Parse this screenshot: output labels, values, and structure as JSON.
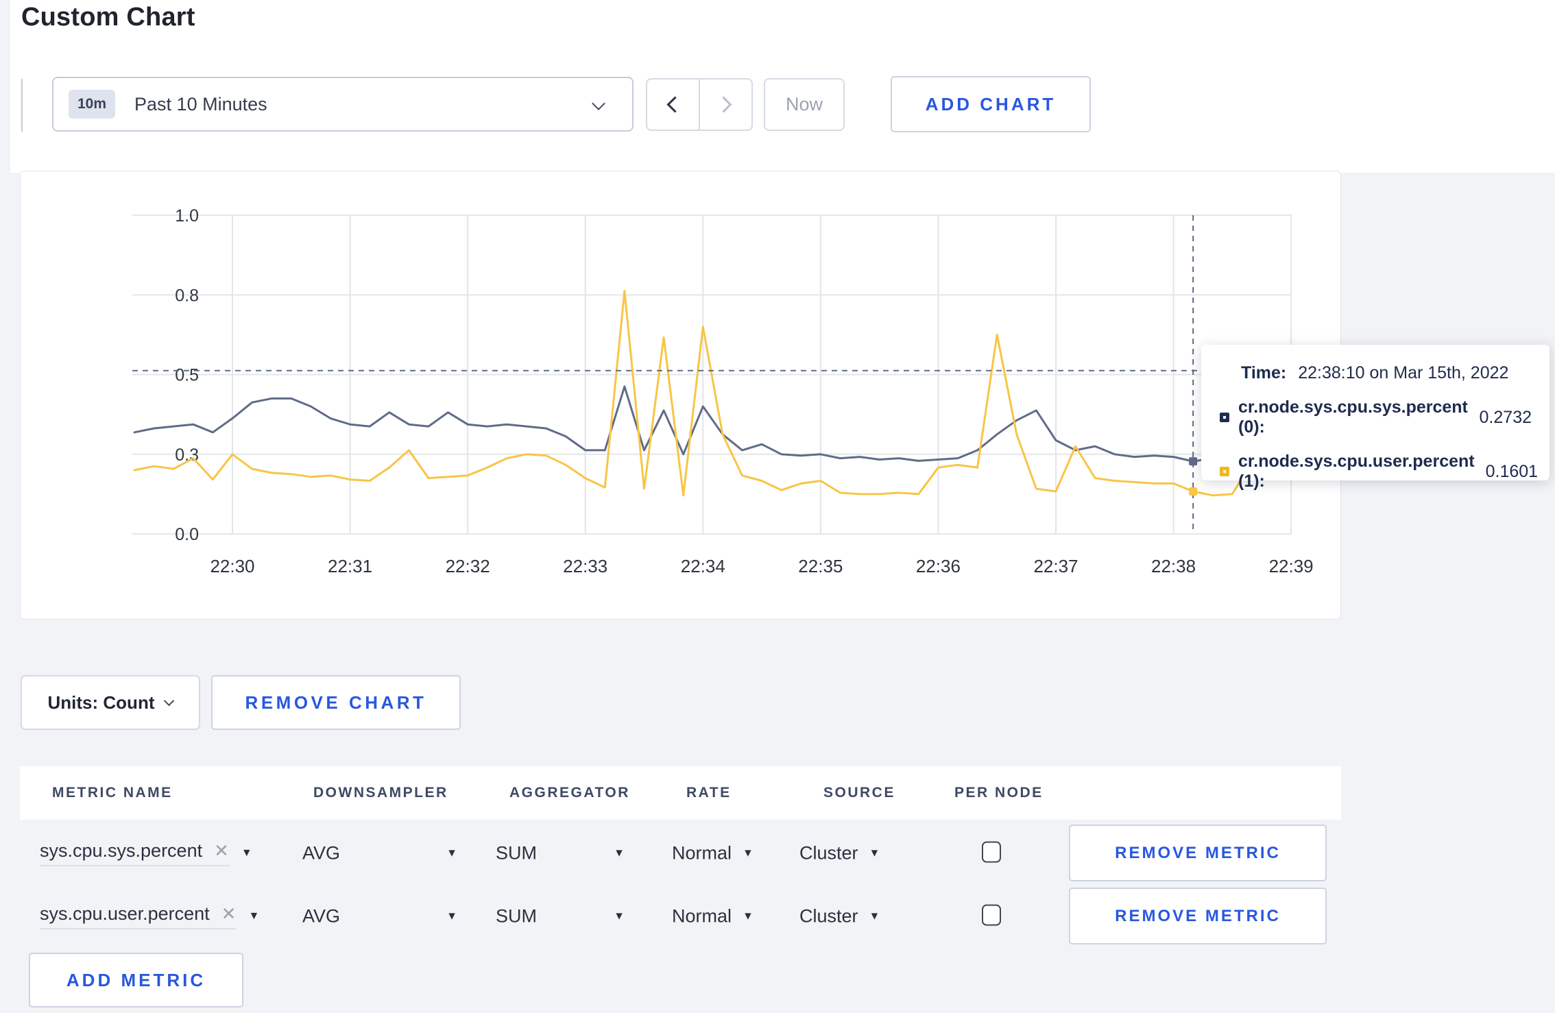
{
  "page": {
    "title": "Custom Chart"
  },
  "toolbar": {
    "time_badge": "10m",
    "time_label": "Past 10 Minutes",
    "now_label": "Now",
    "add_chart_label": "ADD CHART"
  },
  "chart_data": {
    "type": "line",
    "title": "",
    "xlabel": "",
    "ylabel": "",
    "grid": true,
    "legend_position": "tooltip",
    "x_ticks": [
      "22:30",
      "22:31",
      "22:32",
      "22:33",
      "22:34",
      "22:35",
      "22:36",
      "22:37",
      "22:38",
      "22:39"
    ],
    "y_ticks": [
      0.0,
      0.3,
      0.5,
      0.8,
      1.0
    ],
    "y_tick_labels": [
      "0.0",
      "0.3",
      "0.5",
      "0.8",
      "1.0"
    ],
    "series": [
      {
        "name": "cr.node.sys.cpu.sys.percent",
        "node": "(0)",
        "color": "#5f6c87",
        "points": [
          [
            "22:29:10",
            0.355
          ],
          [
            "22:29:20",
            0.365
          ],
          [
            "22:29:30",
            0.37
          ],
          [
            "22:29:40",
            0.375
          ],
          [
            "22:29:50",
            0.355
          ],
          [
            "22:30:00",
            0.39
          ],
          [
            "22:30:10",
            0.43
          ],
          [
            "22:30:20",
            0.44
          ],
          [
            "22:30:30",
            0.44
          ],
          [
            "22:30:40",
            0.42
          ],
          [
            "22:30:50",
            0.39
          ],
          [
            "22:31:00",
            0.375
          ],
          [
            "22:31:10",
            0.37
          ],
          [
            "22:31:20",
            0.405
          ],
          [
            "22:31:30",
            0.375
          ],
          [
            "22:31:40",
            0.37
          ],
          [
            "22:31:50",
            0.405
          ],
          [
            "22:32:00",
            0.375
          ],
          [
            "22:32:10",
            0.37
          ],
          [
            "22:32:20",
            0.375
          ],
          [
            "22:32:30",
            0.37
          ],
          [
            "22:32:40",
            0.365
          ],
          [
            "22:32:50",
            0.345
          ],
          [
            "22:33:00",
            0.31
          ],
          [
            "22:33:10",
            0.31
          ],
          [
            "22:33:20",
            0.47
          ],
          [
            "22:33:30",
            0.31
          ],
          [
            "22:33:40",
            0.41
          ],
          [
            "22:33:50",
            0.3
          ],
          [
            "22:34:00",
            0.42
          ],
          [
            "22:34:10",
            0.35
          ],
          [
            "22:34:20",
            0.31
          ],
          [
            "22:34:30",
            0.325
          ],
          [
            "22:34:40",
            0.3
          ],
          [
            "22:34:50",
            0.295
          ],
          [
            "22:35:00",
            0.3
          ],
          [
            "22:35:10",
            0.285
          ],
          [
            "22:35:20",
            0.29
          ],
          [
            "22:35:30",
            0.28
          ],
          [
            "22:35:40",
            0.285
          ],
          [
            "22:35:50",
            0.275
          ],
          [
            "22:36:00",
            0.28
          ],
          [
            "22:36:10",
            0.285
          ],
          [
            "22:36:20",
            0.31
          ],
          [
            "22:36:30",
            0.35
          ],
          [
            "22:36:40",
            0.385
          ],
          [
            "22:36:50",
            0.41
          ],
          [
            "22:37:00",
            0.335
          ],
          [
            "22:37:10",
            0.31
          ],
          [
            "22:37:20",
            0.32
          ],
          [
            "22:37:30",
            0.3
          ],
          [
            "22:37:40",
            0.29
          ],
          [
            "22:37:50",
            0.295
          ],
          [
            "22:38:00",
            0.29
          ],
          [
            "22:38:10",
            0.2732
          ],
          [
            "22:38:20",
            0.285
          ],
          [
            "22:38:30",
            0.29
          ],
          [
            "22:38:40",
            0.3
          ],
          [
            "22:38:50",
            0.295
          ],
          [
            "22:39:00",
            0.3
          ]
        ]
      },
      {
        "name": "cr.node.sys.cpu.user.percent",
        "node": "(1)",
        "color": "#f8c545",
        "points": [
          [
            "22:29:10",
            0.24
          ],
          [
            "22:29:20",
            0.255
          ],
          [
            "22:29:30",
            0.245
          ],
          [
            "22:29:40",
            0.285
          ],
          [
            "22:29:50",
            0.205
          ],
          [
            "22:30:00",
            0.3
          ],
          [
            "22:30:10",
            0.245
          ],
          [
            "22:30:20",
            0.23
          ],
          [
            "22:30:30",
            0.225
          ],
          [
            "22:30:40",
            0.215
          ],
          [
            "22:30:50",
            0.22
          ],
          [
            "22:31:00",
            0.205
          ],
          [
            "22:31:10",
            0.2
          ],
          [
            "22:31:20",
            0.25
          ],
          [
            "22:31:30",
            0.31
          ],
          [
            "22:31:40",
            0.21
          ],
          [
            "22:31:50",
            0.215
          ],
          [
            "22:32:00",
            0.22
          ],
          [
            "22:32:10",
            0.25
          ],
          [
            "22:32:20",
            0.285
          ],
          [
            "22:32:30",
            0.3
          ],
          [
            "22:32:40",
            0.295
          ],
          [
            "22:32:50",
            0.26
          ],
          [
            "22:33:00",
            0.21
          ],
          [
            "22:33:10",
            0.175
          ],
          [
            "22:33:20",
            0.81
          ],
          [
            "22:33:30",
            0.17
          ],
          [
            "22:33:40",
            0.64
          ],
          [
            "22:33:50",
            0.145
          ],
          [
            "22:34:00",
            0.68
          ],
          [
            "22:34:10",
            0.35
          ],
          [
            "22:34:20",
            0.22
          ],
          [
            "22:34:30",
            0.2
          ],
          [
            "22:34:40",
            0.165
          ],
          [
            "22:34:50",
            0.19
          ],
          [
            "22:35:00",
            0.2
          ],
          [
            "22:35:10",
            0.155
          ],
          [
            "22:35:20",
            0.15
          ],
          [
            "22:35:30",
            0.15
          ],
          [
            "22:35:40",
            0.155
          ],
          [
            "22:35:50",
            0.15
          ],
          [
            "22:36:00",
            0.25
          ],
          [
            "22:36:10",
            0.26
          ],
          [
            "22:36:20",
            0.25
          ],
          [
            "22:36:30",
            0.65
          ],
          [
            "22:36:40",
            0.35
          ],
          [
            "22:36:50",
            0.17
          ],
          [
            "22:37:00",
            0.16
          ],
          [
            "22:37:10",
            0.32
          ],
          [
            "22:37:20",
            0.21
          ],
          [
            "22:37:30",
            0.2
          ],
          [
            "22:37:40",
            0.195
          ],
          [
            "22:37:50",
            0.19
          ],
          [
            "22:38:00",
            0.19
          ],
          [
            "22:38:10",
            0.1601
          ],
          [
            "22:38:20",
            0.145
          ],
          [
            "22:38:30",
            0.15
          ],
          [
            "22:38:40",
            0.27
          ],
          [
            "22:38:50",
            0.25
          ],
          [
            "22:39:00",
            0.24
          ]
        ]
      }
    ]
  },
  "tooltip": {
    "time_prefix": "Time:",
    "time": "22:38:10 on Mar 15th, 2022",
    "crosshair_time": "22:38:10",
    "crosshair_y": 0.515,
    "rows": [
      {
        "label": "cr.node.sys.cpu.sys.percent (0):",
        "value": "0.2732",
        "marker_value": 0.2732,
        "color": "#1e2c4e"
      },
      {
        "label": "cr.node.sys.cpu.user.percent (1):",
        "value": "0.1601",
        "marker_value": 0.1601,
        "color": "#f2b81e"
      }
    ]
  },
  "chart_footer": {
    "units_label": "Units: Count",
    "remove_chart_label": "REMOVE CHART"
  },
  "metrics_table": {
    "headers": [
      "METRIC NAME",
      "DOWNSAMPLER",
      "AGGREGATOR",
      "RATE",
      "SOURCE",
      "PER NODE"
    ],
    "remove_metric_label": "REMOVE METRIC",
    "add_metric_label": "ADD METRIC",
    "close_icon": "✕",
    "caret_icon": "▼",
    "rows": [
      {
        "metric": "sys.cpu.sys.percent",
        "downsampler": "AVG",
        "aggregator": "SUM",
        "rate": "Normal",
        "source": "Cluster",
        "per_node": false
      },
      {
        "metric": "sys.cpu.user.percent",
        "downsampler": "AVG",
        "aggregator": "SUM",
        "rate": "Normal",
        "source": "Cluster",
        "per_node": false
      }
    ]
  }
}
